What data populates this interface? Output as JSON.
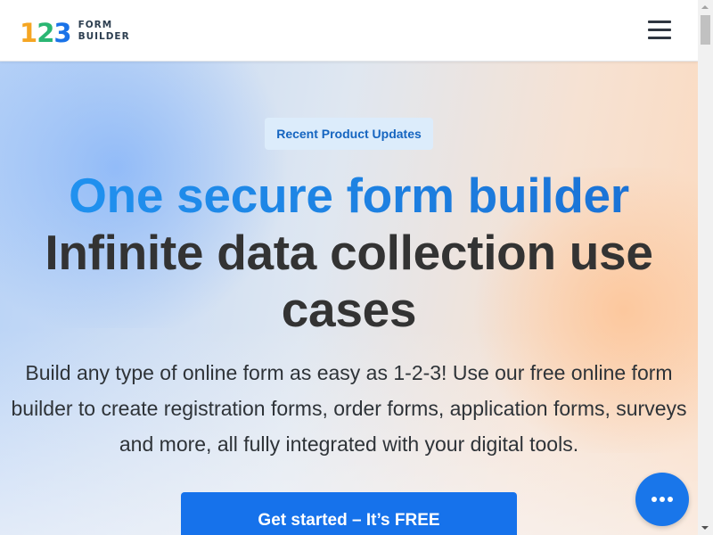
{
  "header": {
    "logo": {
      "digits": [
        "1",
        "2",
        "3"
      ],
      "text_line1": "FORM",
      "text_line2": "BUILDER"
    },
    "menu_icon": "hamburger-menu-icon"
  },
  "hero": {
    "badge_label": "Recent Product Updates",
    "headline_primary": "One secure form builder",
    "headline_secondary": "Infinite data collection use cases",
    "subtitle": "Build any type of online form as easy as 1-2-3! Use our free online form builder to create registration forms, order forms, application forms, surveys and more, all fully integrated with your digital tools.",
    "cta_label": "Get started – It’s FREE"
  },
  "chat_widget": {
    "icon": "chat-bubble-icon"
  },
  "colors": {
    "brand_blue": "#1672eb",
    "headline_blue": "#2195f2",
    "headline_dark": "#333333",
    "badge_bg": "#dcecfb",
    "logo_orange": "#f5a623",
    "logo_green": "#2bb673",
    "logo_blue": "#1a73e8"
  }
}
